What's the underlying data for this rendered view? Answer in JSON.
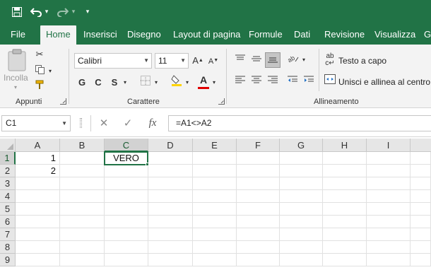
{
  "accent_color": "#217346",
  "quick_access": {
    "save_icon": "save-icon",
    "undo_icon": "undo-icon",
    "redo_icon": "redo-icon",
    "customize_icon": "customize-qat-icon"
  },
  "tabs": [
    {
      "label": "File",
      "active": false
    },
    {
      "label": "Home",
      "active": true
    },
    {
      "label": "Inserisci",
      "active": false
    },
    {
      "label": "Disegno",
      "active": false
    },
    {
      "label": "Layout di pagina",
      "active": false
    },
    {
      "label": "Formule",
      "active": false
    },
    {
      "label": "Dati",
      "active": false
    },
    {
      "label": "Revisione",
      "active": false
    },
    {
      "label": "Visualizza",
      "active": false
    },
    {
      "label": "G",
      "active": false
    }
  ],
  "ribbon": {
    "clipboard": {
      "paste_label": "Incolla",
      "group_label": "Appunti"
    },
    "font": {
      "font_name": "Calibri",
      "font_size": "11",
      "bold": "G",
      "italic": "C",
      "underline": "S",
      "grow_font": "A",
      "shrink_font": "A",
      "font_color_letter": "A",
      "fill_color": "#ffd400",
      "font_color": "#e00000",
      "group_label": "Carattere"
    },
    "alignment": {
      "wrap_text": "Testo a capo",
      "merge_center": "Unisci e allinea al centro",
      "group_label": "Allineamento"
    }
  },
  "formula_bar": {
    "name_box": "C1",
    "cancel_icon": "cancel-icon",
    "enter_icon": "enter-icon",
    "fx_label": "fx",
    "formula": "=A1<>A2"
  },
  "grid": {
    "columns": [
      "A",
      "B",
      "C",
      "D",
      "E",
      "F",
      "G",
      "H",
      "I"
    ],
    "rows": [
      "1",
      "2",
      "3",
      "4",
      "5",
      "6",
      "7",
      "8",
      "9"
    ],
    "selected_column": "C",
    "selected_row": "1",
    "cells": {
      "A1": "1",
      "A2": "2",
      "C1": "VERO"
    }
  }
}
